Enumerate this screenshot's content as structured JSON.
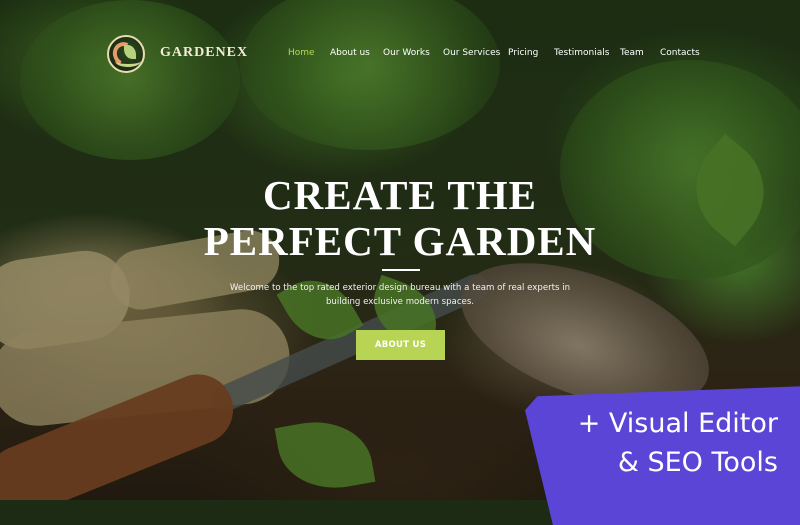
{
  "brand": {
    "name": "GARDENEX",
    "logo_icon": "leaf-emblem-icon"
  },
  "nav": {
    "items": [
      {
        "label": "Home",
        "active": true
      },
      {
        "label": "About us",
        "active": false
      },
      {
        "label": "Our Works",
        "active": false
      },
      {
        "label": "Our Services",
        "active": false
      },
      {
        "label": "Pricing",
        "active": false
      },
      {
        "label": "Testimonials",
        "active": false
      },
      {
        "label": "Team",
        "active": false
      },
      {
        "label": "Contacts",
        "active": false
      }
    ]
  },
  "hero": {
    "title_line1": "CREATE THE",
    "title_line2": "PERFECT GARDEN",
    "text_line1": "Welcome to the top rated exterior design bureau with a team of real experts in",
    "text_line2": "building exclusive modern spaces.",
    "cta_label": "ABOUT US"
  },
  "promo": {
    "line1": "+ Visual Editor",
    "line2": "& SEO Tools"
  },
  "colors": {
    "accent": "#b8d454",
    "nav_active": "#b9d85a",
    "promo_bg": "#5a45d6",
    "logo_orange": "#e59b6a"
  }
}
